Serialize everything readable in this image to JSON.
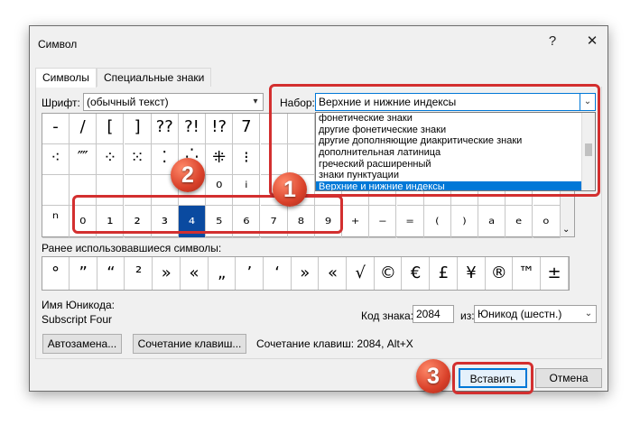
{
  "dialog": {
    "title": "Символ",
    "help": "?",
    "close": "✕",
    "tabs": [
      "Символы",
      "Специальные знаки"
    ],
    "font_label": "Шрифт:",
    "font_value": "(обычный текст)",
    "subset_label": "Набор:",
    "subset_value": "Верхние и нижние индексы",
    "subset_options": [
      "фонетические знаки",
      "другие фонетические знаки",
      "другие дополняющие диакритические знаки",
      "дополнительная латиница",
      "греческий расширенный",
      "знаки пунктуации",
      "Верхние и нижние индексы"
    ],
    "grid_rows": [
      [
        "‐",
        "/",
        "[",
        "]",
        "??",
        "?!",
        "!?",
        "7",
        "",
        "",
        "",
        "",
        "",
        "",
        "",
        "",
        "",
        "",
        ""
      ],
      [
        "⁖",
        "⁗",
        "⁘",
        "⁙",
        "⁚",
        "⁛",
        "⁜",
        "⁝",
        "",
        "",
        "",
        "",
        "",
        "",
        "",
        "",
        "",
        "",
        ""
      ],
      [
        "",
        "",
        "",
        "",
        "",
        "",
        "⁰",
        "ⁱ",
        "",
        "",
        "",
        "",
        "",
        "",
        "",
        "",
        "",
        "",
        ""
      ],
      [
        "ⁿ",
        "₀",
        "₁",
        "₂",
        "₃",
        "₄",
        "₅",
        "₆",
        "₇",
        "₈",
        "₉",
        "₊",
        "₋",
        "₌",
        "₍",
        "₎",
        "ₐ",
        "ₑ",
        "ₒ"
      ]
    ],
    "recent_label": "Ранее использовавшиеся символы:",
    "recent_symbols": [
      "°",
      "”",
      "“",
      "²",
      "»",
      "«",
      "„",
      "’",
      "‘",
      "»",
      "«",
      "√",
      "©",
      "€",
      "£",
      "¥",
      "®",
      "™",
      "±"
    ],
    "unicode_name_label": "Имя Юникода:",
    "unicode_name": "Subscript Four",
    "code_label": "Код знака:",
    "code_value": "2084",
    "from_label": "из:",
    "from_value": "Юникод (шестн.)",
    "autocorrect_btn": "Автозамена...",
    "shortcut_btn": "Сочетание клавиш...",
    "shortcut_text": "Сочетание клавиш: 2084, Alt+X",
    "insert_btn": "Вставить",
    "cancel_btn": "Отмена"
  },
  "annotations": {
    "badge1": "1",
    "badge2": "2",
    "badge3": "3",
    "color": "#d32f2f"
  }
}
